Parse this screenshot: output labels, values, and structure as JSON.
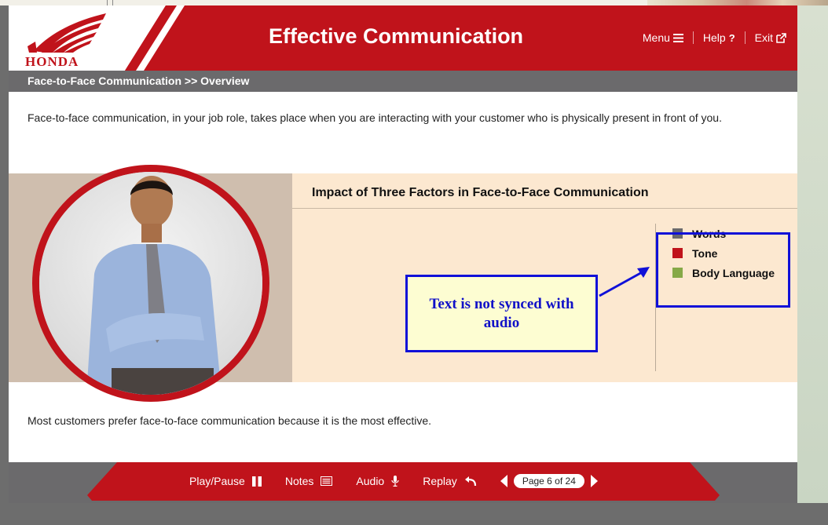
{
  "header": {
    "brand": "HONDA",
    "title": "Effective Communication",
    "nav": [
      {
        "label": "Menu",
        "icon": "hamburger-icon"
      },
      {
        "label": "Help",
        "icon": "question-icon"
      },
      {
        "label": "Exit",
        "icon": "external-link-icon"
      }
    ]
  },
  "breadcrumb": "Face-to-Face Communication >> Overview",
  "intro_text": "Face-to-face communication, in your job role, takes place when you are interacting with your customer who is physically present in front of you.",
  "panel": {
    "title": "Impact of Three Factors in Face-to-Face Communication",
    "legend": [
      {
        "label": "Words",
        "color": "#6b6a6c"
      },
      {
        "label": "Tone",
        "color": "#c0131b"
      },
      {
        "label": "Body Language",
        "color": "#86a947"
      }
    ]
  },
  "annotation": "Text is not synced with audio",
  "outro_text": "Most customers prefer face-to-face communication because it is the most effective.",
  "footer": {
    "play_pause": "Play/Pause",
    "notes": "Notes",
    "audio": "Audio",
    "replay": "Replay",
    "page": "Page 6 of 24"
  },
  "colors": {
    "brand_red": "#c0131b",
    "bar_gray": "#6b6a6c",
    "annotation_blue": "#1010d8"
  }
}
